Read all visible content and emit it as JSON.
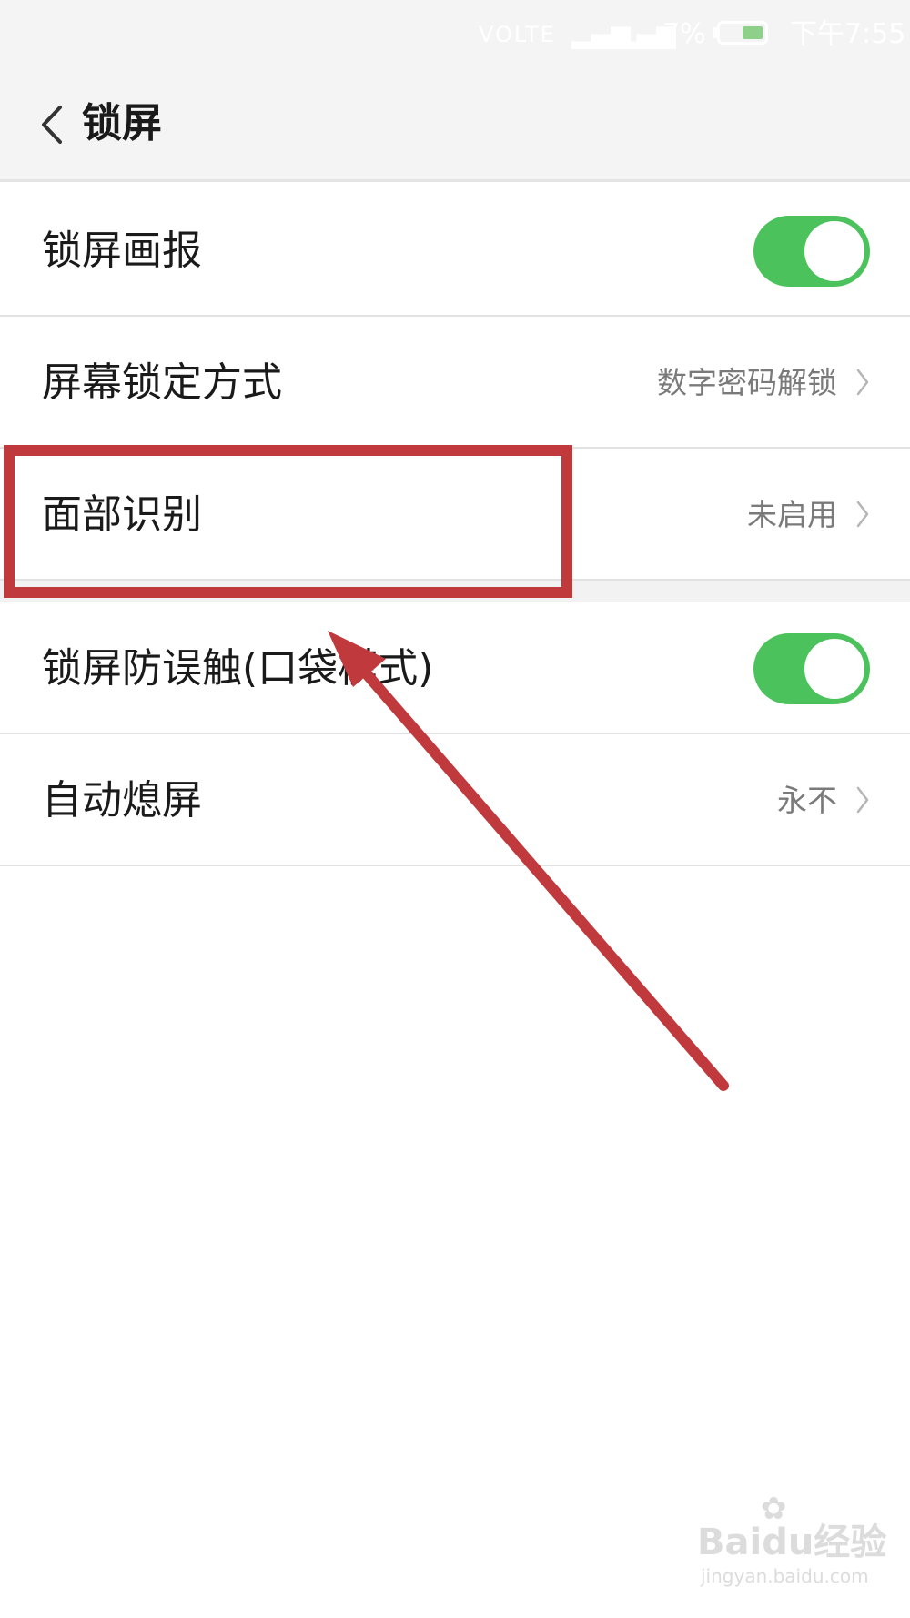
{
  "status_bar": {
    "network": "VOLTE",
    "battery_percent": "7%",
    "time": "下午7:55",
    "signal_icon": "signal-icon",
    "battery_icon": "battery-icon",
    "battery_color": "#8ed08a"
  },
  "header": {
    "back_icon": "chevron-left-icon",
    "title": "锁屏"
  },
  "settings": {
    "items": [
      {
        "label": "锁屏画报",
        "type": "toggle",
        "on": true
      },
      {
        "label": "屏幕锁定方式",
        "type": "link",
        "value": "数字密码解锁"
      },
      {
        "label": "面部识别",
        "type": "link",
        "value": "未启用"
      },
      {
        "label": "锁屏防误触(口袋模式)",
        "type": "toggle",
        "on": true
      },
      {
        "label": "自动熄屏",
        "type": "link",
        "value": "永不"
      }
    ]
  },
  "annotation": {
    "highlight_color": "#c0393d",
    "highlighted_item": "面部识别"
  },
  "colors": {
    "toggle_on": "#4cc25c",
    "header_bg": "#f4f4f4"
  },
  "watermark": {
    "main": "Baidu经验",
    "sub": "jingyan.baidu.com"
  }
}
